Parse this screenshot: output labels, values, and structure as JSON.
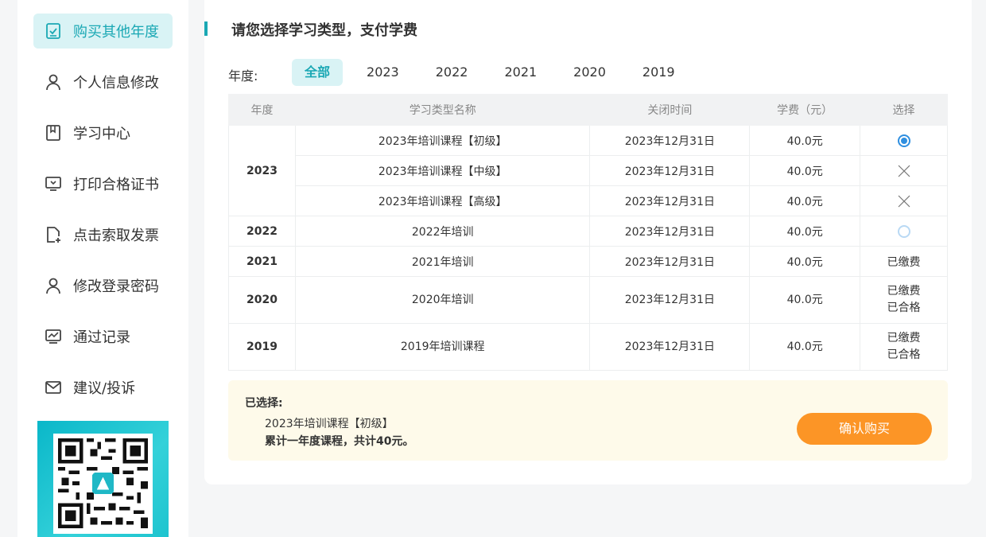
{
  "sidebar": {
    "items": [
      {
        "label": "购买其他年度",
        "icon": "checklist-icon",
        "active": true
      },
      {
        "label": "个人信息修改",
        "icon": "user-icon"
      },
      {
        "label": "学习中心",
        "icon": "book-icon"
      },
      {
        "label": "打印合格证书",
        "icon": "monitor-icon"
      },
      {
        "label": "点击索取发票",
        "icon": "document-add-icon"
      },
      {
        "label": "修改登录密码",
        "icon": "user-icon"
      },
      {
        "label": "通过记录",
        "icon": "chart-icon"
      },
      {
        "label": "建议/投诉",
        "icon": "mail-icon"
      }
    ],
    "qr_icon": "qr-code-icon"
  },
  "main": {
    "title": "请您选择学习类型，支付学费",
    "year_filter_label": "年度:",
    "tabs": [
      "全部",
      "2023",
      "2022",
      "2021",
      "2020",
      "2019"
    ],
    "active_tab": "全部"
  },
  "table": {
    "headers": [
      "年度",
      "学习类型名称",
      "关闭时间",
      "学费（元）",
      "选择"
    ],
    "groups": [
      {
        "year": "2023",
        "rows": [
          {
            "name": "2023年培训课程【初级】",
            "close": "2023年12月31日",
            "fee": "40.0元",
            "select": "radio-checked"
          },
          {
            "name": "2023年培训课程【中级】",
            "close": "2023年12月31日",
            "fee": "40.0元",
            "select": "unavailable"
          },
          {
            "name": "2023年培训课程【高级】",
            "close": "2023年12月31日",
            "fee": "40.0元",
            "select": "unavailable"
          }
        ]
      },
      {
        "year": "2022",
        "rows": [
          {
            "name": "2022年培训",
            "close": "2023年12月31日",
            "fee": "40.0元",
            "select": "radio-empty"
          }
        ]
      },
      {
        "year": "2021",
        "rows": [
          {
            "name": "2021年培训",
            "close": "2023年12月31日",
            "fee": "40.0元",
            "select": "text",
            "status": [
              "已缴费"
            ]
          }
        ]
      },
      {
        "year": "2020",
        "rows": [
          {
            "name": "2020年培训",
            "close": "2023年12月31日",
            "fee": "40.0元",
            "select": "text",
            "status": [
              "已缴费",
              "已合格"
            ]
          }
        ]
      },
      {
        "year": "2019",
        "rows": [
          {
            "name": "2019年培训课程",
            "close": "2023年12月31日",
            "fee": "40.0元",
            "select": "text",
            "status": [
              "已缴费",
              "已合格"
            ]
          }
        ]
      }
    ]
  },
  "summary": {
    "label": "已选择:",
    "item": "2023年培训课程【初级】",
    "total": "累计一年度课程，共计40元。",
    "confirm_label": "确认购买"
  },
  "colors": {
    "accent": "#1aa8b4",
    "active_bg": "#d9f3f5",
    "button": "#fc9526",
    "radio": "#2f8fe0",
    "summary_bg": "#fefaea"
  }
}
